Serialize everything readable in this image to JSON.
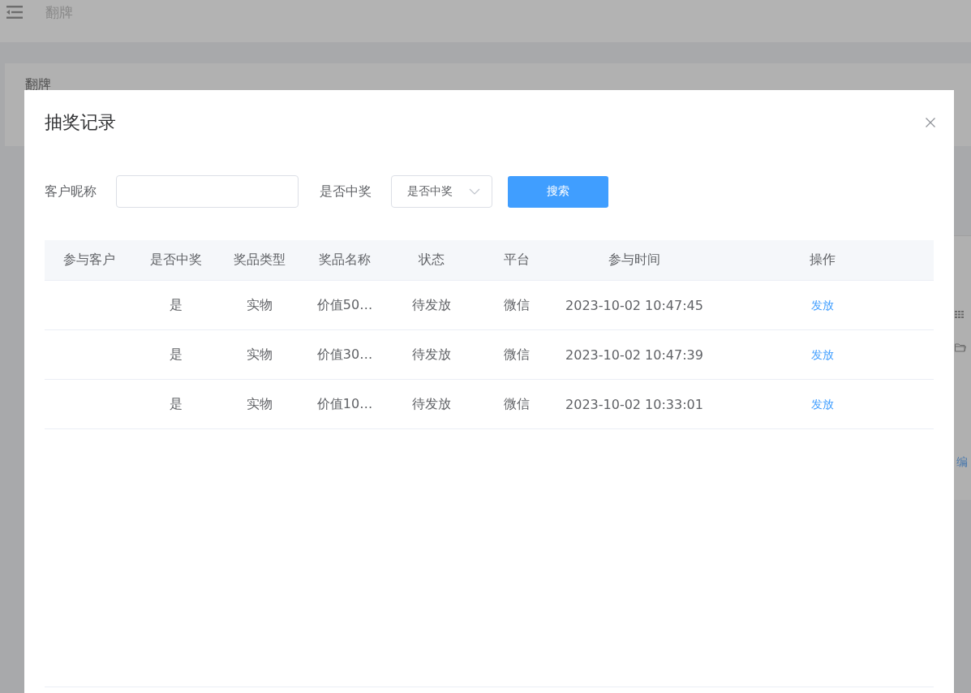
{
  "page": {
    "header_title": "翻牌",
    "card_title": "翻牌",
    "side_link": "编"
  },
  "dialog": {
    "title": "抽奖记录",
    "filters": [
      {
        "kind": "input",
        "label": "客户昵称"
      },
      {
        "kind": "select",
        "label": "是否中奖",
        "placeholder": "是否中奖"
      }
    ],
    "search_button": "搜索",
    "table": {
      "columns": [
        "参与客户",
        "是否中奖",
        "奖品类型",
        "奖品名称",
        "状态",
        "平台",
        "参与时间",
        "操作"
      ],
      "rows": [
        {
          "cells": [
            null,
            "是",
            "实物",
            "价值50…",
            "待发放",
            "微信",
            "2023-10-02 10:47:45"
          ],
          "action": "发放"
        },
        {
          "cells": [
            null,
            "是",
            "实物",
            "价值30…",
            "待发放",
            "微信",
            "2023-10-02 10:47:39"
          ],
          "action": "发放"
        },
        {
          "cells": [
            null,
            "是",
            "实物",
            "价值10…",
            "待发放",
            "微信",
            "2023-10-02 10:33:01"
          ],
          "action": "发放"
        }
      ]
    }
  }
}
